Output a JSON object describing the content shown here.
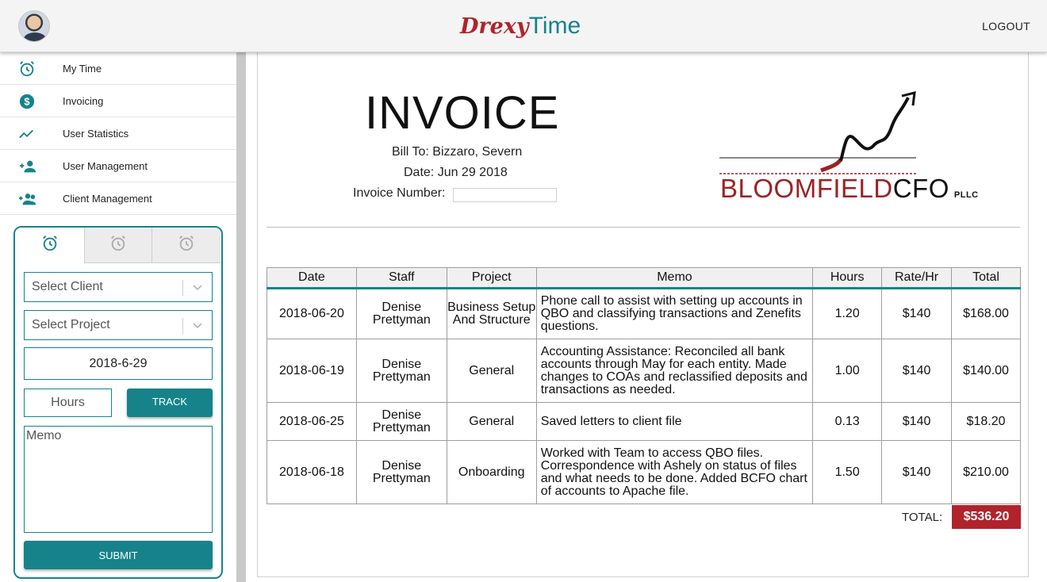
{
  "app": {
    "brand_part1": "Drexy",
    "brand_part2": "Time",
    "logout_label": "LOGOUT"
  },
  "sidebar": {
    "items": [
      {
        "label": "My Time",
        "icon": "alarm-clock-icon"
      },
      {
        "label": "Invoicing",
        "icon": "dollar-circle-icon"
      },
      {
        "label": "User Statistics",
        "icon": "trending-up-icon"
      },
      {
        "label": "User Management",
        "icon": "person-add-icon"
      },
      {
        "label": "Client Management",
        "icon": "group-add-icon"
      }
    ]
  },
  "tracker": {
    "tabs": [
      "timer-1",
      "timer-2",
      "timer-3"
    ],
    "active_tab": 0,
    "select_client_placeholder": "Select Client",
    "select_project_placeholder": "Select Project",
    "date_value": "2018-6-29",
    "hours_placeholder": "Hours",
    "track_label": "TRACK",
    "memo_placeholder": "Memo",
    "submit_label": "SUBMIT"
  },
  "invoice": {
    "title": "INVOICE",
    "bill_to": "Bill To: Bizzaro, Severn",
    "date": "Date: Jun 29 2018",
    "invoice_number_label": "Invoice Number:",
    "invoice_number_value": "",
    "logo_name_part1": "BLOOMFIELD",
    "logo_name_part2": "CFO",
    "logo_suffix": "PLLC",
    "columns": [
      "Date",
      "Staff",
      "Project",
      "Memo",
      "Hours",
      "Rate/Hr",
      "Total"
    ],
    "rows": [
      {
        "date": "2018-06-20",
        "staff": "Denise Prettyman",
        "project": "Business Setup And Structure",
        "memo": "Phone call to assist with setting up accounts in QBO and classifying transactions and Zenefits questions.",
        "hours": "1.20",
        "rate": "$140",
        "total": "$168.00"
      },
      {
        "date": "2018-06-19",
        "staff": "Denise Prettyman",
        "project": "General",
        "memo": "Accounting Assistance: Reconciled all bank accounts through May for each entity. Made changes to COAs and reclassified deposits and transactions as needed.",
        "hours": "1.00",
        "rate": "$140",
        "total": "$140.00"
      },
      {
        "date": "2018-06-25",
        "staff": "Denise Prettyman",
        "project": "General",
        "memo": "Saved letters to client file",
        "hours": "0.13",
        "rate": "$140",
        "total": "$18.20"
      },
      {
        "date": "2018-06-18",
        "staff": "Denise Prettyman",
        "project": "Onboarding",
        "memo": "Worked with Team to access QBO files. Correspondence with Ashely on status of files and what needs to be done. Added BCFO chart of accounts to Apache file.",
        "hours": "1.50",
        "rate": "$140",
        "total": "$210.00"
      }
    ],
    "total_label": "TOTAL:",
    "total_value": "$536.20"
  },
  "colors": {
    "accent": "#16838b",
    "brand_red": "#b1232b"
  }
}
